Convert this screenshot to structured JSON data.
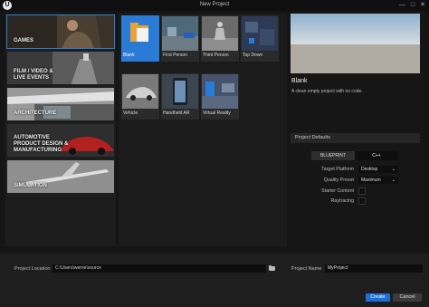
{
  "window": {
    "title": "New Project",
    "logo": "U"
  },
  "categories": [
    {
      "label": "GAMES",
      "active": true
    },
    {
      "label": "FILM / VIDEO &\nLIVE EVENTS",
      "active": false
    },
    {
      "label": "ARCHITECTURE",
      "active": false
    },
    {
      "label": "AUTOMOTIVE\nPRODUCT DESIGN &\nMANUFACTURING",
      "active": false
    },
    {
      "label": "SIMULATION",
      "active": false
    }
  ],
  "templates": [
    {
      "label": "Blank",
      "selected": true
    },
    {
      "label": "First Person",
      "selected": false
    },
    {
      "label": "Third Person",
      "selected": false
    },
    {
      "label": "Top Down",
      "selected": false
    },
    {
      "label": "Vehicle",
      "selected": false
    },
    {
      "label": "Handheld AR",
      "selected": false
    },
    {
      "label": "Virtual Reality",
      "selected": false
    }
  ],
  "detail": {
    "title": "Blank",
    "description": "A clean empty project with no code.",
    "defaults_header": "Project Defaults",
    "blueprint_label": "BLUEPRINT",
    "cpp_label": "C++",
    "target_platform_label": "Target Platform",
    "target_platform_value": "Desktop",
    "quality_preset_label": "Quality Preset",
    "quality_preset_value": "Maximum",
    "starter_content_label": "Starter Content",
    "raytracing_label": "Raytracing"
  },
  "footer": {
    "location_label": "Project Location",
    "location_value": "C:\\Users\\werne\\source",
    "name_label": "Project Name",
    "name_value": "MyProject",
    "create_label": "Create",
    "cancel_label": "Cancel"
  },
  "colors": {
    "accent": "#2a7bd6",
    "create": "#1d6fd6"
  }
}
